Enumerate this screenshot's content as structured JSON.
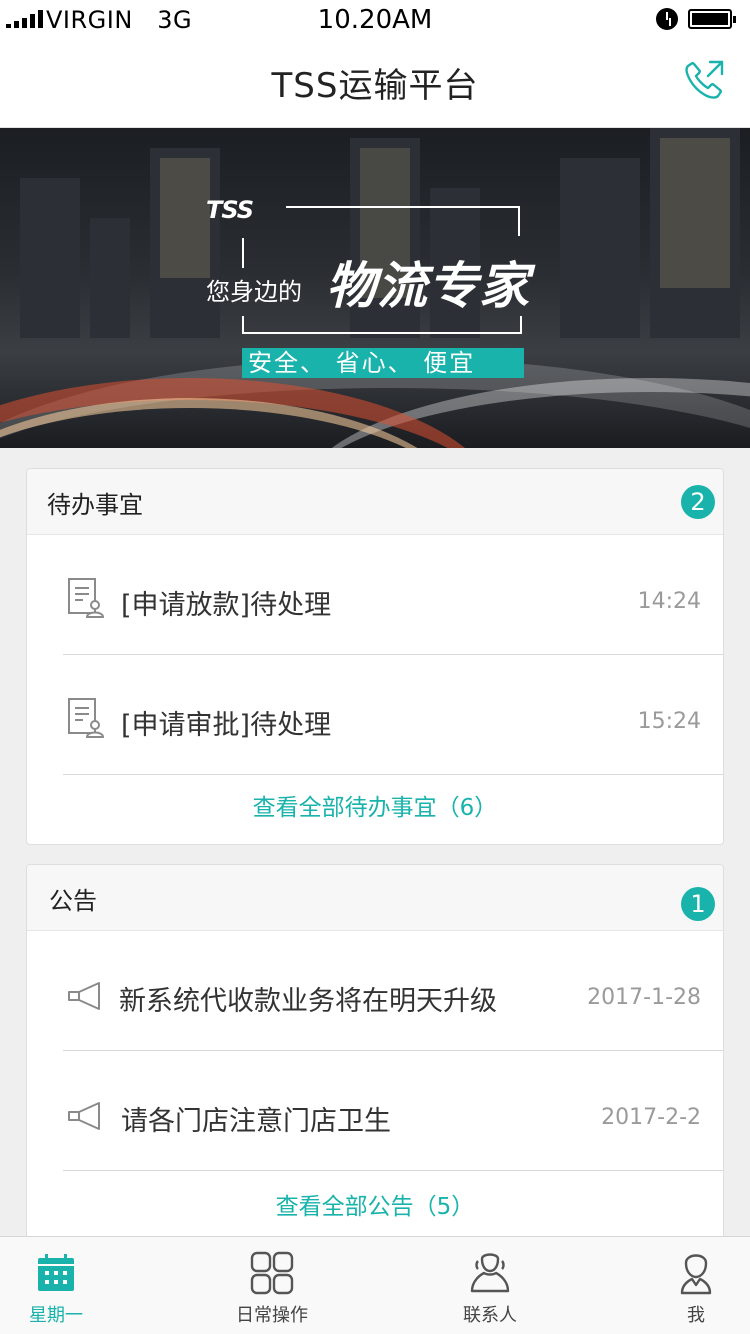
{
  "status_bar": {
    "carrier": "VIRGIN   3G",
    "time": "10.20AM"
  },
  "nav": {
    "title": "TSS运输平台",
    "call_icon": "phone-call-icon"
  },
  "banner": {
    "logo": "TSS",
    "tagline_small": "您身边的",
    "tagline_big": "物流专家",
    "slogan": "安全、 省心、 便宜"
  },
  "todo": {
    "title": "待办事宜",
    "count": "2",
    "items": [
      {
        "text": "[申请放款]待处理",
        "time": "14:24",
        "icon": "document-user-icon"
      },
      {
        "text": "[申请审批]待处理",
        "time": "15:24",
        "icon": "document-user-icon"
      }
    ],
    "view_all": "查看全部待办事宜（6）"
  },
  "notice": {
    "title": "公告",
    "count": "1",
    "items": [
      {
        "text": "新系统代收款业务将在明天升级",
        "time": "2017-1-28",
        "icon": "megaphone-icon"
      },
      {
        "text": "请各门店注意门店卫生",
        "time": "2017-2-2",
        "icon": "megaphone-icon"
      }
    ],
    "view_all": "查看全部公告（5）"
  },
  "tabs": [
    {
      "label": "星期一",
      "icon": "calendar-icon",
      "active": true
    },
    {
      "label": "日常操作",
      "icon": "grid-icon",
      "active": false
    },
    {
      "label": "联系人",
      "icon": "contacts-icon",
      "active": false
    },
    {
      "label": "我",
      "icon": "user-icon",
      "active": false
    }
  ],
  "colors": {
    "accent": "#19b3ab",
    "secondary_text": "#9a9a9a"
  }
}
